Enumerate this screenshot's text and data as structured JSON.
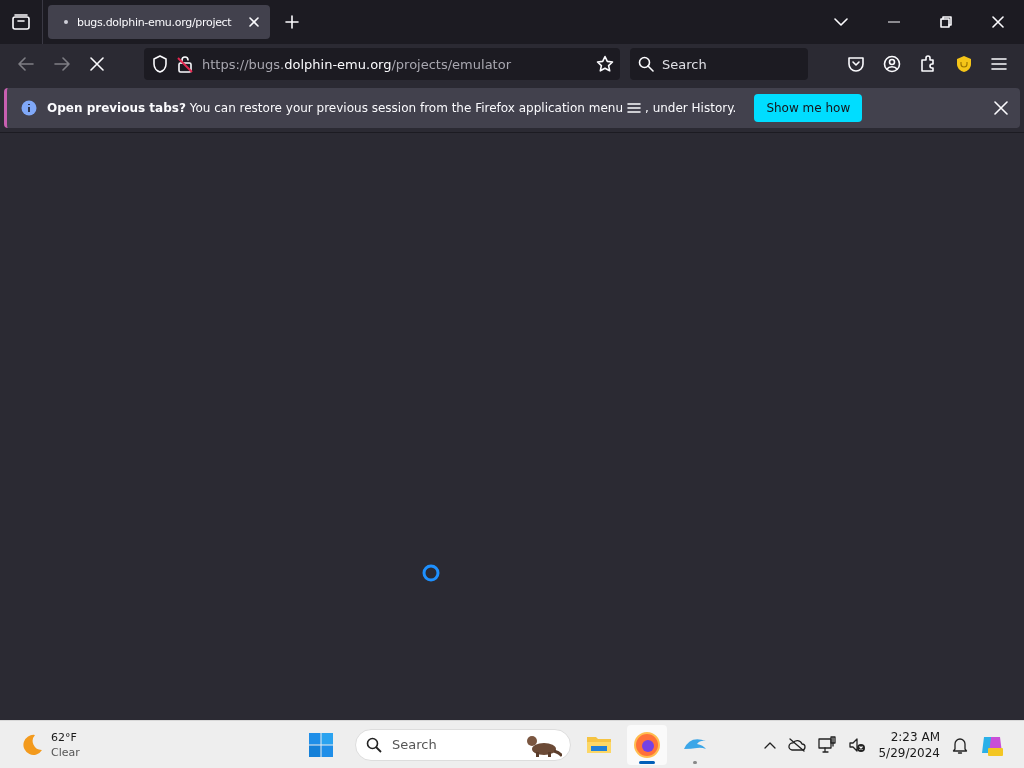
{
  "tabs": [
    {
      "title": "bugs.dolphin-emu.org/project",
      "selected": true,
      "loading": true
    }
  ],
  "toolbar": {
    "back_disabled": true,
    "forward_disabled": true,
    "url": {
      "prefix": "https://bugs.",
      "domain": "dolphin-emu.org",
      "path": "/projects/emulator"
    },
    "search": {
      "placeholder": "Search"
    }
  },
  "notification": {
    "message": "**Open previous tabs?** You can restore your previous session from the Firefox application menu",
    "message_end": ", under History.",
    "button": "Show me how"
  },
  "page": {
    "loading": true
  },
  "taskbar": {
    "weather": {
      "temperature": "62°F",
      "condition": "Clear"
    },
    "search": {
      "placeholder": "Search"
    },
    "apps": [
      {
        "kind": "folder",
        "active": false,
        "running": false
      },
      {
        "kind": "firefox",
        "active": true,
        "running": true
      },
      {
        "kind": "dolphin",
        "active": false,
        "running": true
      }
    ],
    "clock": {
      "time": "2:23 AM",
      "date": "5/29/2024"
    }
  }
}
